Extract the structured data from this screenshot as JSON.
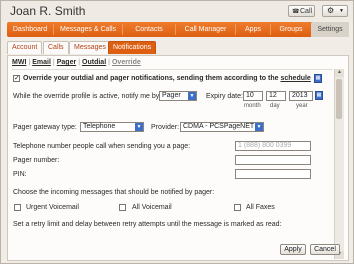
{
  "window": {
    "title": "Joan R. Smith",
    "call_label": "Call",
    "call_icon": "phone-icon",
    "settings_icon": "gear-icon"
  },
  "nav": {
    "items": [
      "Dashboard",
      "Messages & Calls",
      "Contacts",
      "Call Manager",
      "Apps",
      "Groups",
      "Settings"
    ],
    "active": "Settings"
  },
  "subtabs": {
    "items": [
      "Account",
      "Calls",
      "Messages",
      "Notifications"
    ],
    "active": "Notifications"
  },
  "links": {
    "items": [
      "MWI",
      "Email",
      "Pager",
      "Outdial",
      "Override"
    ],
    "active": "Override"
  },
  "override": {
    "checkbox_label": "Override your outdial and pager notifications, sending them according to the ",
    "schedule_link": "schedule",
    "checked": true,
    "notify_label": "While the override profile is active, notify me by:",
    "notify_value": "Pager",
    "expiry_label": "Expiry date:",
    "month": "10",
    "day": "12",
    "year": "2013",
    "month_label": "month",
    "day_label": "day",
    "year_label": "year"
  },
  "pager": {
    "gateway_label": "Pager gateway type:",
    "gateway_value": "Telephone",
    "provider_label": "Provider:",
    "provider_value": "CDMA - PCSPageNET",
    "phone_label": "Telephone number people call when sending you a page:",
    "phone_placeholder": "1 (888) 800 0399",
    "number_label": "Pager number:",
    "pin_label": "PIN:"
  },
  "messages": {
    "label": "Choose the incoming messages that should be notified by pager:",
    "options": [
      "Urgent Voicemail",
      "All Voicemail",
      "All Faxes"
    ],
    "retry_label": "Set a retry limit and delay between retry attempts until the message is marked as read:"
  },
  "actions": {
    "apply": "Apply",
    "cancel": "Cancel"
  },
  "colors": {
    "accent": "#dd5f12",
    "link_blue": "#3d6fc8"
  }
}
